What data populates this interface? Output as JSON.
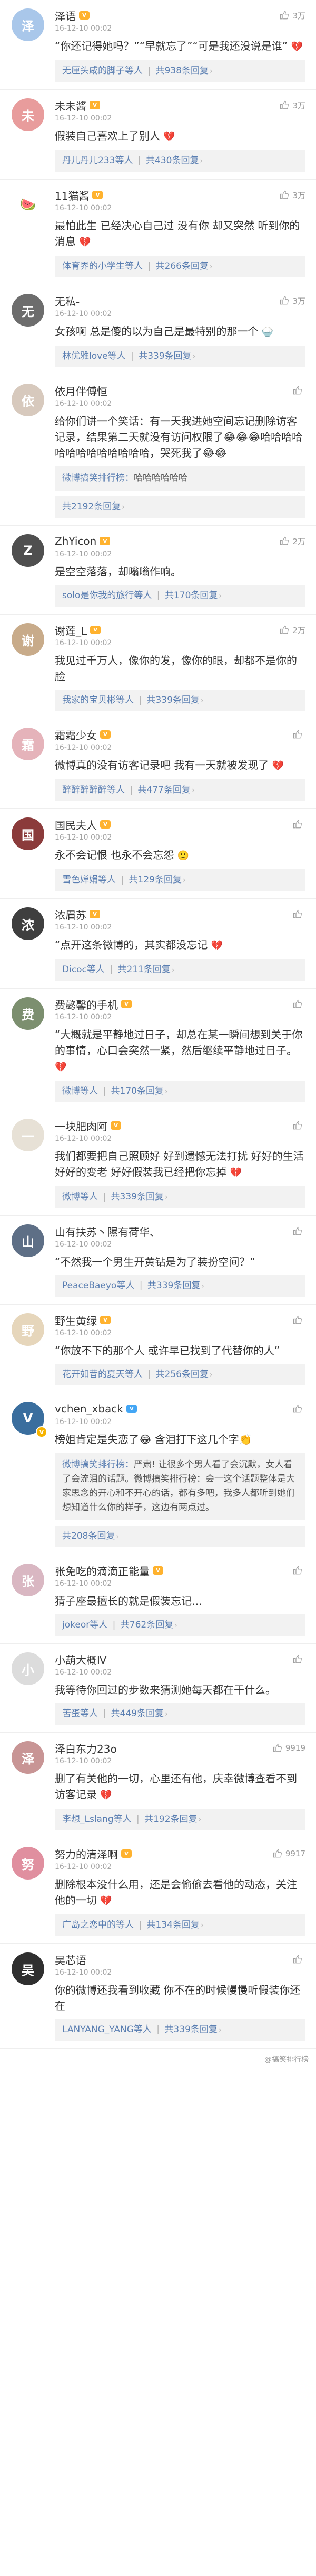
{
  "comments": [
    {
      "username": "泽语",
      "level_badge": "V",
      "level_color": "#ffb22e",
      "likes": "3万",
      "time": "16-12-10 00:02",
      "text": "“你还记得她吗？”“早就忘了”“可是我还没说是谁”",
      "emoji": "💔",
      "avatar_initial": "泽",
      "avatar_color": "#a9c7ea",
      "verified": false,
      "more_users": "无厘头咸的脚子等人",
      "more_count": "共938条回复"
    },
    {
      "username": "未未酱",
      "level_badge": "V",
      "level_color": "#ffb22e",
      "likes": "3万",
      "time": "16-12-10 00:02",
      "text": "假装自己喜欢上了别人",
      "emoji": "💔",
      "avatar_initial": "未",
      "avatar_color": "#e89c9c",
      "verified": false,
      "more_users": "丹儿丹儿233等人",
      "more_count": "共430条回复"
    },
    {
      "username": "11猫酱",
      "level_badge": "V",
      "level_color": "#ffb22e",
      "likes": "3万",
      "time": "16-12-10 00:02",
      "text": "最怕此生 已经决心自己过 没有你 却又突然 听到你的消息",
      "emoji": "💔",
      "avatar_initial": "🍉",
      "avatar_color": "#ffffff",
      "verified": false,
      "more_users": "体育界的小学生等人",
      "more_count": "共266条回复"
    },
    {
      "username": "无私-",
      "level_badge": "",
      "level_color": "#ffb22e",
      "likes": "3万",
      "time": "16-12-10 00:02",
      "text": "女孩啊 总是傻的以为自己是最特别的那一个",
      "emoji": "🍚",
      "avatar_initial": "无",
      "avatar_color": "#6d6d6d",
      "verified": false,
      "more_users": "林优雅love等人",
      "more_count": "共339条回复"
    },
    {
      "username": "依月伴傅恒",
      "level_badge": "",
      "level_color": "#ffb22e",
      "likes": "",
      "time": "16-12-10 00:02",
      "text": "给你们讲一个笑话：有一天我进她空间忘记删除访客记录，结果第二天就没有访问权限了😂😂😂哈哈哈哈哈哈哈哈哈哈哈哈哈，哭死我了😂😂",
      "emoji": "",
      "avatar_initial": "依",
      "avatar_color": "#d7c9bd",
      "verified": false,
      "reply_user": "微博搞笑排行榜：",
      "reply_text": "哈哈哈哈哈哈",
      "more_users": "",
      "more_count": "共2192条回复"
    },
    {
      "username": "ZhYicon",
      "level_badge": "V",
      "level_color": "#ffb22e",
      "likes": "2万",
      "time": "16-12-10 00:02",
      "text": "是空空落落，却嗡嗡作响。",
      "emoji": "",
      "avatar_initial": "Z",
      "avatar_color": "#4f4f4f",
      "verified": false,
      "more_users": "solo是你我的旅行等人",
      "more_count": "共170条回复"
    },
    {
      "username": "谢莲_L",
      "level_badge": "V",
      "level_color": "#ffb22e",
      "likes": "2万",
      "time": "16-12-10 00:02",
      "text": "我见过千万人，像你的发，像你的眼，却都不是你的脸",
      "emoji": "",
      "avatar_initial": "谢",
      "avatar_color": "#c8ab8a",
      "verified": false,
      "more_users": "我家的宝贝彬等人",
      "more_count": "共339条回复"
    },
    {
      "username": "霜霜少女",
      "level_badge": "V",
      "level_color": "#ffb22e",
      "likes": "",
      "time": "16-12-10 00:02",
      "text": "微博真的没有访客记录吧 我有一天就被发现了",
      "emoji": "💔",
      "avatar_initial": "霜",
      "avatar_color": "#e5b3ba",
      "verified": false,
      "more_users": "醉醉醉醉醉等人",
      "more_count": "共477条回复"
    },
    {
      "username": "国民夫人",
      "level_badge": "V",
      "level_color": "#ffb22e",
      "likes": "",
      "time": "16-12-10 00:02",
      "text": "永不会记恨 也永不会忘怨",
      "emoji": "🙂",
      "avatar_initial": "国",
      "avatar_color": "#8b3b3b",
      "verified": false,
      "more_users": "雪色婵娟等人",
      "more_count": "共129条回复"
    },
    {
      "username": "浓眉苏",
      "level_badge": "V",
      "level_color": "#ffb22e",
      "likes": "",
      "time": "16-12-10 00:02",
      "text": "“点开这条微博的，其实都没忘记",
      "emoji": "💔",
      "avatar_initial": "浓",
      "avatar_color": "#3f3f3f",
      "verified": false,
      "more_users": "Dicoc等人",
      "more_count": "共211条回复"
    },
    {
      "username": "费懿馨的手机",
      "level_badge": "V",
      "level_color": "#ffb22e",
      "likes": "",
      "time": "16-12-10 00:02",
      "text": "“大概就是平静地过日子，却总在某一瞬间想到关于你的事情，心口会突然一紧，然后继续平静地过日子。",
      "emoji": "💔",
      "avatar_initial": "费",
      "avatar_color": "#7c8f6f",
      "verified": false,
      "more_users": "微博等人",
      "more_count": "共170条回复"
    },
    {
      "username": "一块肥肉阿",
      "level_badge": "V",
      "level_color": "#ffb22e",
      "likes": "",
      "time": "16-12-10 00:02",
      "text": "我们都要把自己照顾好 好到遗憾无法打扰 好好的生活好好的变老 好好假装我已经把你忘掉",
      "emoji": "💔",
      "avatar_initial": "一",
      "avatar_color": "#e7e1d6",
      "verified": false,
      "more_users": "微博等人",
      "more_count": "共339条回复"
    },
    {
      "username": "山有扶苏丶隰有荷华、",
      "level_badge": "",
      "level_color": "#ffb22e",
      "likes": "",
      "time": "16-12-10 00:02",
      "text": "“不然我一个男生开黄钻是为了装扮空间？”",
      "emoji": "",
      "avatar_initial": "山",
      "avatar_color": "#5e6f86",
      "verified": false,
      "more_users": "PeaceBaeyo等人",
      "more_count": "共339条回复"
    },
    {
      "username": "野生黄绿",
      "level_badge": "V",
      "level_color": "#ffb22e",
      "likes": "",
      "time": "16-12-10 00:02",
      "text": "“你放不下的那个人 或许早已找到了代替你的人”",
      "emoji": "",
      "avatar_initial": "野",
      "avatar_color": "#e6d6bb",
      "verified": false,
      "more_users": "花开如昔的夏天等人",
      "more_count": "共256条回复"
    },
    {
      "username": "vchen_xback",
      "level_badge": "V",
      "level_color": "#43a6f5",
      "likes": "",
      "time": "16-12-10 00:02",
      "text": "榜姐肯定是失恋了😂 含泪打下这几个字👏",
      "emoji": "",
      "avatar_initial": "V",
      "avatar_color": "#3a6e9e",
      "verified": true,
      "reply_user": "微博搞笑排行榜：",
      "reply_text": "严肃! 让很多个男人看了会沉默，女人看了会流泪的话题。微博搞笑排行榜：会一这个话题整体是大家思念的开心和不开心的话，都有多吧，我多人都听到她们想知道什么你的样子，这边有两点过。",
      "more_users": "",
      "more_count": "共208条回复"
    },
    {
      "username": "张免吃的滴滴正能量",
      "level_badge": "V",
      "level_color": "#ffb22e",
      "likes": "",
      "time": "16-12-10 00:02",
      "text": "猜子座最擅长的就是假装忘记…",
      "emoji": "",
      "avatar_initial": "张",
      "avatar_color": "#d9b7c2",
      "verified": false,
      "more_users": "jokeor等人",
      "more_count": "共762条回复"
    },
    {
      "username": "小葫大概Ⅳ",
      "level_badge": "",
      "level_color": "#ffb22e",
      "likes": "",
      "time": "16-12-10 00:02",
      "text": "我等待你回过的步数来猜测她每天都在干什么。",
      "emoji": "",
      "avatar_initial": "小",
      "avatar_color": "#dcdcdc",
      "verified": false,
      "more_users": "苦蛋等人",
      "more_count": "共449条回复"
    },
    {
      "username": "泽白东力23o",
      "level_badge": "",
      "level_color": "#ffb22e",
      "likes": "9919",
      "time": "16-12-10 00:02",
      "text": "删了有关他的一切，心里还有他，庆幸微博查看不到访客记录",
      "emoji": "💔",
      "avatar_initial": "泽",
      "avatar_color": "#c89595",
      "verified": false,
      "more_users": "李想_Lslang等人",
      "more_count": "共192条回复"
    },
    {
      "username": "努力的清泽啊",
      "level_badge": "V",
      "level_color": "#ffb22e",
      "likes": "9917",
      "time": "16-12-10 00:02",
      "text": "删除根本没什么用，还是会偷偷去看他的动态，关注他的一切",
      "emoji": "💔",
      "avatar_initial": "努",
      "avatar_color": "#e08f9f",
      "verified": false,
      "more_users": "广岛之恋中的等人",
      "more_count": "共134条回复"
    },
    {
      "username": "吴芯语",
      "level_badge": "",
      "level_color": "#ffb22e",
      "likes": "",
      "time": "16-12-10 00:02",
      "text": "你的微博还我看到收藏 你不在的时候慢慢听假装你还在",
      "emoji": "",
      "avatar_initial": "吴",
      "avatar_color": "#2f2f2f",
      "verified": false,
      "more_users": "LANYANG_YANG等人",
      "more_count": "共339条回复"
    }
  ],
  "footer": {
    "watermark": "@搞笑排行榜"
  },
  "colors": {
    "link": "#5b7fb2",
    "badge_gold": "#ffb22e",
    "heart": "#e0245e"
  },
  "icons": {
    "like": "thumb-up-icon",
    "caret": "chevron-right-icon",
    "verified": "verified-badge-icon"
  }
}
